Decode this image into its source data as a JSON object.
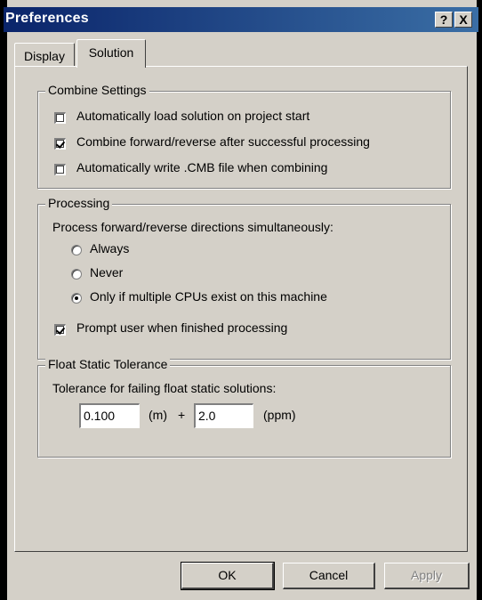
{
  "window": {
    "title": "Preferences",
    "help_glyph": "?",
    "close_glyph": "X"
  },
  "tabs": [
    {
      "label": "Display",
      "selected": false
    },
    {
      "label": "Solution",
      "selected": true
    }
  ],
  "combine_settings": {
    "label": "Combine Settings",
    "options": [
      {
        "label": "Automatically load solution on project start",
        "checked": false
      },
      {
        "label": "Combine forward/reverse after successful processing",
        "checked": true
      },
      {
        "label": "Automatically write .CMB file when combining",
        "checked": false
      }
    ]
  },
  "processing": {
    "label": "Processing",
    "prompt": "Process forward/reverse directions simultaneously:",
    "radios": [
      {
        "label": "Always",
        "selected": false
      },
      {
        "label": "Never",
        "selected": false
      },
      {
        "label": "Only if multiple CPUs exist on this machine",
        "selected": true
      }
    ],
    "prompt_user": {
      "label": "Prompt user when finished processing",
      "checked": true
    }
  },
  "float_static": {
    "label": "Float Static Tolerance",
    "description": "Tolerance for failing float static solutions:",
    "value_m": "0.100",
    "unit_m": "(m)",
    "plus": "+",
    "value_ppm": "2.0",
    "unit_ppm": "(ppm)"
  },
  "buttons": {
    "ok": "OK",
    "cancel": "Cancel",
    "apply": "Apply"
  }
}
